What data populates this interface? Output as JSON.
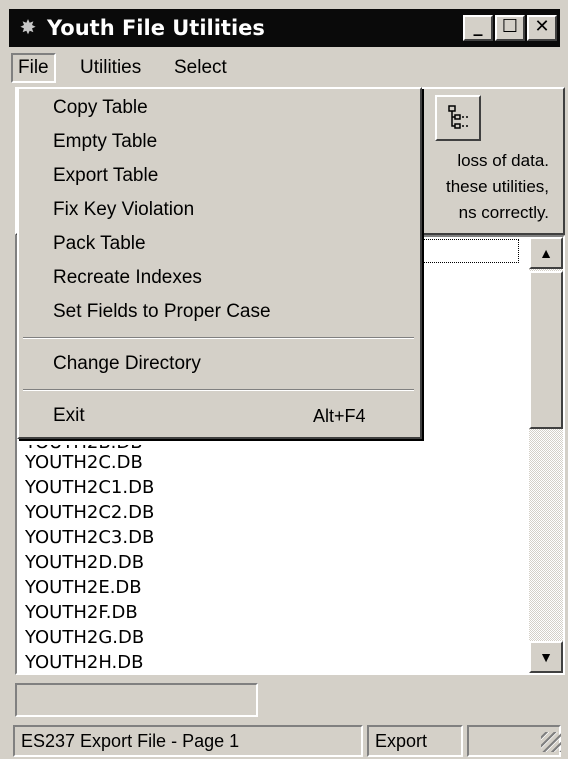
{
  "window": {
    "title": "Youth File Utilities",
    "icon": "app-icon",
    "controls": {
      "minimize": "_",
      "maximize": "☐",
      "close": "✕"
    }
  },
  "menubar": {
    "items": [
      {
        "label": "File"
      },
      {
        "label": "Utilities"
      },
      {
        "label": "Select"
      }
    ]
  },
  "file_menu": {
    "items": [
      {
        "label": "Copy Table"
      },
      {
        "label": "Empty Table"
      },
      {
        "label": "Export Table"
      },
      {
        "label": "Fix Key Violation"
      },
      {
        "label": "Pack Table"
      },
      {
        "label": "Recreate Indexes"
      },
      {
        "label": "Set Fields to Proper Case"
      },
      {
        "label": "Change Directory"
      },
      {
        "label": "Exit",
        "shortcut": "Alt+F4"
      }
    ]
  },
  "info_panel": {
    "icon": "hierarchy-icon",
    "lines": [
      "loss of data.",
      "these utilities,",
      "ns correctly."
    ]
  },
  "file_list": {
    "items": [
      "YOUTH2C.DB",
      "YOUTH2C1.DB",
      "YOUTH2C2.DB",
      "YOUTH2C3.DB",
      "YOUTH2D.DB",
      "YOUTH2E.DB",
      "YOUTH2F.DB",
      "YOUTH2G.DB",
      "YOUTH2H.DB"
    ],
    "scroll_up": "▲",
    "scroll_down": "▼"
  },
  "statusbar": {
    "left": "ES237 Export File - Page 1",
    "middle": "Export",
    "right": ""
  }
}
